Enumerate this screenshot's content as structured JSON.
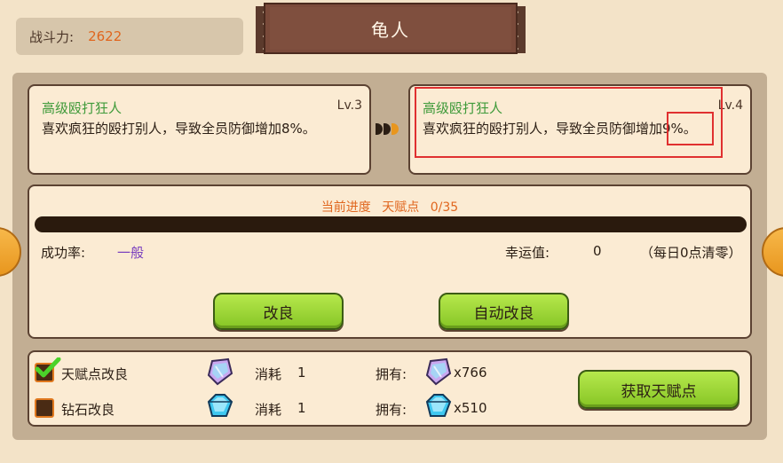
{
  "header": {
    "power_label": "战斗力:",
    "power_value": "2622",
    "title": "龟人"
  },
  "current_talent": {
    "name": "高级殴打狂人",
    "level": "Lv.3",
    "description": "喜欢疯狂的殴打别人，导致全员防御增加8%。"
  },
  "next_talent": {
    "name": "高级殴打狂人",
    "level": "Lv.4",
    "description": "喜欢疯狂的殴打别人，导致全员防御增加9%。"
  },
  "progress": {
    "label": "当前进度",
    "resource": "天赋点",
    "value_text": "0/35",
    "current": 0,
    "max": 35
  },
  "stats": {
    "success_label": "成功率:",
    "success_value": "一般",
    "luck_label": "幸运值:",
    "luck_value": "0",
    "luck_note": "（每日0点清零）"
  },
  "buttons": {
    "improve": "改良",
    "auto_improve": "自动改良",
    "get_points": "获取天赋点"
  },
  "options": [
    {
      "label": "天赋点改良",
      "checked": true,
      "gem": "crystal-icon",
      "cost_label": "消耗",
      "cost": "1",
      "own_label": "拥有:",
      "own": "x766"
    },
    {
      "label": "钻石改良",
      "checked": false,
      "gem": "diamond-icon",
      "cost_label": "消耗",
      "cost": "1",
      "own_label": "拥有:",
      "own": "x510"
    }
  ],
  "colors": {
    "accent_orange": "#e0661e",
    "name_green": "#3f9a3a",
    "highlight_red": "#e03030",
    "purple": "#7a3fbf"
  }
}
